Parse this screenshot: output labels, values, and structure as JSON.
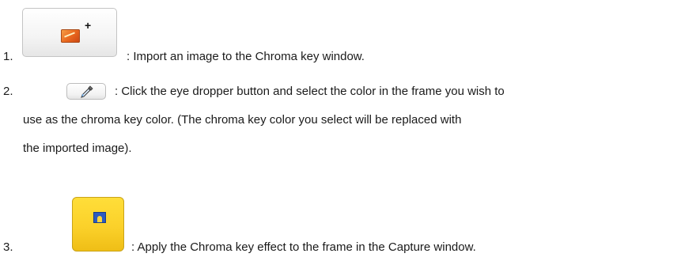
{
  "items": [
    {
      "number": "1.",
      "lines": [
        ": Import an image to the Chroma key window."
      ]
    },
    {
      "number": "2.",
      "lines": [
        ": Click the eye dropper button and select the color in the frame you wish to",
        "use as the chroma key color. (The chroma key color you select will be replaced with",
        "the imported image)."
      ]
    },
    {
      "number": "3.",
      "lines": [
        ": Apply the Chroma key effect to the frame in the Capture window."
      ]
    }
  ],
  "icons": {
    "import": "image-plus-icon",
    "dropper": "eye-dropper-icon",
    "apply": "chroma-key-apply-icon"
  },
  "colors": {
    "apply_button": "#fbd12a",
    "image_icon": "#e8651d",
    "screen_icon": "#2d5bbf"
  }
}
